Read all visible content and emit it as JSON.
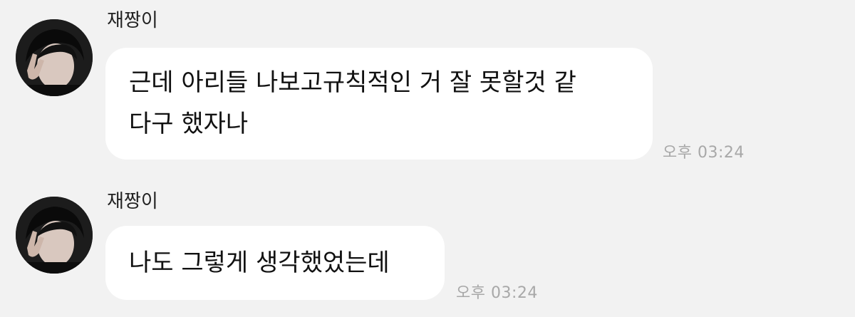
{
  "messages": [
    {
      "sender": "재짱이",
      "lines": [
        "근데 아리들 나보고규칙적인 거 잘 못할것 같",
        "다구 했자나"
      ],
      "time": "오후 03:24"
    },
    {
      "sender": "재짱이",
      "lines": [
        "나도 그렇게 생각했었는데"
      ],
      "time": "오후 03:24"
    }
  ],
  "colors": {
    "background": "#f2f2f2",
    "bubble": "#ffffff",
    "text": "#111111",
    "timestamp": "#a8a8a8"
  },
  "icons": {
    "avatar": "profile-photo"
  }
}
